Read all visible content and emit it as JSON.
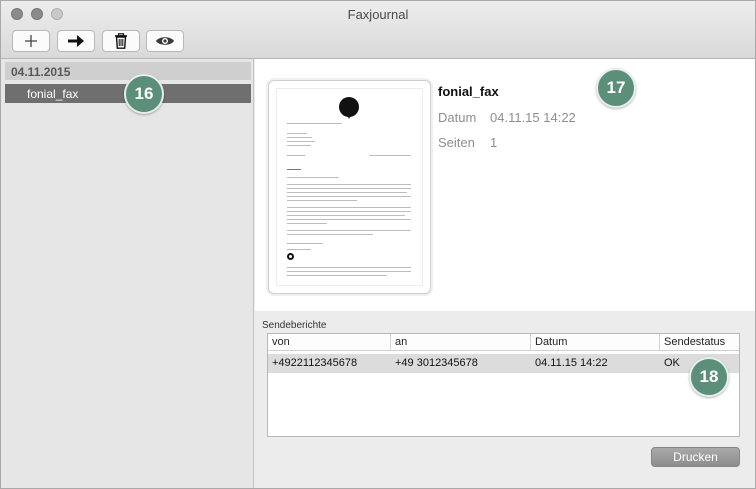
{
  "window": {
    "title": "Faxjournal"
  },
  "toolbar": {
    "buttons": [
      {
        "name": "add",
        "icon": "plus-icon"
      },
      {
        "name": "send",
        "icon": "arrow-right-icon"
      },
      {
        "name": "delete",
        "icon": "trash-icon"
      },
      {
        "name": "preview",
        "icon": "eye-icon"
      }
    ]
  },
  "sidebar": {
    "group_date": "04.11.2015",
    "items": [
      {
        "label": "fonial_fax",
        "selected": true
      }
    ]
  },
  "detail": {
    "name": "fonial_fax",
    "date_label": "Datum",
    "date_value": "04.11.15 14:22",
    "pages_label": "Seiten",
    "pages_value": "1"
  },
  "reports": {
    "label": "Sendeberichte",
    "columns": [
      "von",
      "an",
      "Datum",
      "Sendestatus"
    ],
    "rows": [
      [
        "+4922112345678",
        "+49 3012345678",
        "04.11.15 14:22",
        "OK"
      ]
    ]
  },
  "actions": {
    "print": "Drucken"
  },
  "callouts": [
    "16",
    "17",
    "18"
  ],
  "colors": {
    "callout": "#5b8f79",
    "selection": "#6f6f6f"
  }
}
